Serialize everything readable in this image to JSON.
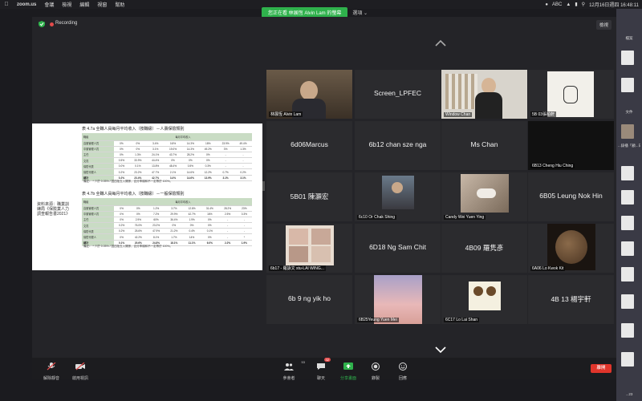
{
  "menubar": {
    "app": "zoom.us",
    "items": [
      "會議",
      "檢視",
      "編輯",
      "視窗",
      "幫助"
    ],
    "status_icons": [
      "zoom-icon",
      "wifi-icon",
      "battery-icon",
      "search-icon"
    ],
    "input_method": "ABC",
    "clock": "12月16日週四 16:48:11"
  },
  "share_banner": {
    "text": "您正在看 林展恆 Alvin Lam 的螢幕",
    "options": "選項 ⌄"
  },
  "zoom": {
    "recording_label": "Recording",
    "view_label": "檢視",
    "colors": {
      "accent_green": "#2fb24c",
      "record_red": "#e24a4a",
      "active_speaker": "#e6d23a",
      "leave_red": "#e0352b"
    }
  },
  "shared_doc": {
    "table1_title": "表 4.7a        全職人員每月平均收入（按職級）－人壽保險類別",
    "table2_title": "表 4.7b        全職人員每月平均收入（按職級）－一般保險類別",
    "col_header": "每月平均收入",
    "row_labels": [
      "職級",
      "高層管理人員",
      "中層管理人員",
      "主任",
      "文員",
      "保險代表",
      "保險代理人",
      "總計"
    ],
    "note1": "備註： *    少於 0.05% / 因四捨五入關係，百分率總和不一定等於 100%。",
    "note2": "備註： *    少於 0.05% / 因四捨五入關係，百分率總和不一定等於 100%。",
    "side_note": "資料來源：職業訓練局《保險業人力調查報告書2021》"
  },
  "participants": [
    {
      "name": "林展恆 Alvin Lam",
      "type": "video"
    },
    {
      "name": "Screen_LPFEC",
      "type": "name"
    },
    {
      "name": "Window Chan",
      "type": "video"
    },
    {
      "name": "5B 03張柏軒",
      "type": "video"
    },
    {
      "name": "6d06Marcus",
      "type": "name"
    },
    {
      "name": "6b12 chan sze nga",
      "type": "name"
    },
    {
      "name": "Ms Chan",
      "type": "name"
    },
    {
      "name": "6B13 Cheng Hiu Ching",
      "type": "video"
    },
    {
      "name": "5B01 陳灝宏",
      "type": "name"
    },
    {
      "name": "6c10 Or Chak Shing",
      "type": "video"
    },
    {
      "name": "Candy Wei Yuen Ying",
      "type": "video"
    },
    {
      "name": "6B05 Leung Nok Hin",
      "type": "name"
    },
    {
      "name": "6b17 - 羅詠文 stu-LAI WING...",
      "type": "video"
    },
    {
      "name": "6D18 Ng Sam Chit",
      "type": "name"
    },
    {
      "name": "4B09 羅隽彥",
      "type": "name"
    },
    {
      "name": "6A06 Lo Kwok Kit",
      "type": "video"
    },
    {
      "name": "6b 9 ng yik ho",
      "type": "name"
    },
    {
      "name": "6B25Yeung Yuen Mei",
      "type": "video"
    },
    {
      "name": "6C17 Lo Lai Shan",
      "type": "video"
    },
    {
      "name": "4B 13 楊宇軒",
      "type": "name"
    }
  ],
  "toolbar": {
    "unmute": "解除靜音",
    "start_video": "啟用視訊",
    "participants": "參會者",
    "participants_count": "53",
    "chat": "聊天",
    "chat_badge": "32",
    "share_screen": "分享畫面",
    "record": "錄製",
    "reactions": "回應",
    "leave": "離開"
  },
  "desktop": {
    "labels": [
      "檔案",
      "文件",
      "...錄播「顧...日).mp4",
      "...23"
    ]
  }
}
